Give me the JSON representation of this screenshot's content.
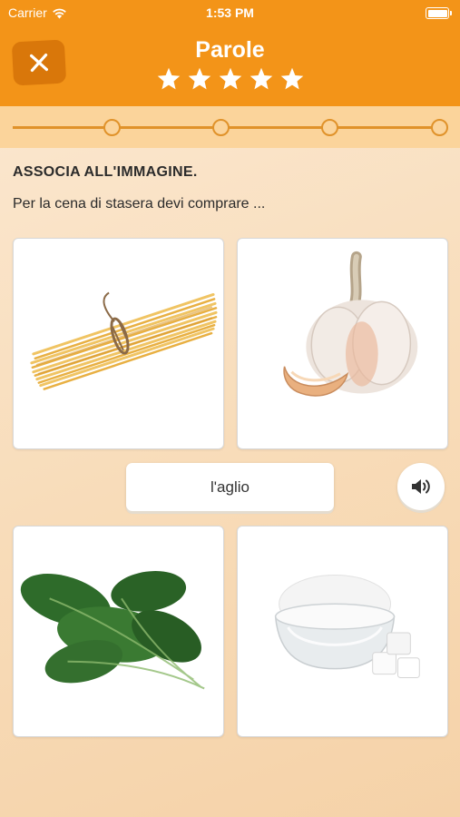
{
  "status_bar": {
    "carrier": "Carrier",
    "time": "1:53 PM",
    "wifi_icon": "wifi-icon",
    "battery_icon": "battery-icon"
  },
  "header": {
    "title": "Parole",
    "close_icon": "close-icon",
    "stars_count": 5,
    "accent_color": "#f39418",
    "close_bg_color": "#d9770a"
  },
  "progress": {
    "step_count": 4,
    "current_step": 0,
    "line_color": "#e0922a"
  },
  "exercise": {
    "instruction": "ASSOCIA ALL'IMMAGINE.",
    "prompt": "Per la cena di stasera devi comprare ..."
  },
  "choices": [
    {
      "image": "spaghetti-image"
    },
    {
      "image": "garlic-image"
    },
    {
      "image": "spinach-image"
    },
    {
      "image": "sugar-image"
    }
  ],
  "answer": {
    "word": "l'aglio",
    "speaker_icon": "speaker-icon"
  }
}
